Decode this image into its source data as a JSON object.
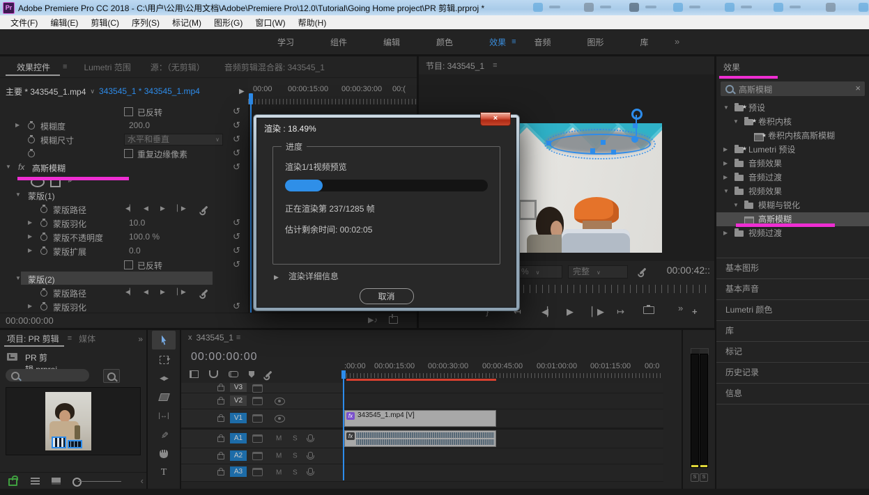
{
  "colors": {
    "accent": "#2d8ceb",
    "annotation": "#ee2ed2",
    "render_red": "#d8402f",
    "progress_blue": "#2f8fe8",
    "track_blue": "#1d6ca8",
    "workspace_active": "#3a8bd8"
  },
  "glyphs": {
    "panel_menu": "≡",
    "overflow": "»",
    "dropdown": "∨",
    "caret_down": "▼",
    "caret_right": "▶",
    "reset": "↺",
    "clear": "×",
    "chevron_left": "‹",
    "note": "▶♪",
    "plus": "+",
    "tab_close": "x",
    "head_arrow": "▶"
  },
  "title_bar": {
    "app_name": "Pr",
    "title": "Adobe Premiere Pro CC 2018 - C:\\用户\\公用\\公用文档\\Adobe\\Premiere Pro\\12.0\\Tutorial\\Going Home project\\PR 剪辑.prproj *"
  },
  "menu_bar": {
    "items": [
      "文件(F)",
      "编辑(E)",
      "剪辑(C)",
      "序列(S)",
      "标记(M)",
      "图形(G)",
      "窗口(W)",
      "帮助(H)"
    ]
  },
  "workspace": {
    "tabs": [
      "学习",
      "组件",
      "编辑",
      "颜色",
      "效果",
      "音频",
      "图形",
      "库"
    ],
    "active": "效果",
    "overflow": "»"
  },
  "effect_controls": {
    "tabs": [
      "效果控件",
      "Lumetri 范围",
      "源：（无剪辑）",
      "音频剪辑混合器: 343545_1"
    ],
    "master_label": "主要 * 343545_1.mp4",
    "clip_label": "343545_1 * 343545_1.mp4",
    "ruler": [
      "00:00",
      "00:00:15:00",
      "00:00:30:00",
      "00:("
    ],
    "kf": [
      "◀▏",
      "◀",
      "▶",
      "▏▶"
    ],
    "rows": [
      {
        "label": "已反转"
      },
      {
        "label": "模糊度",
        "value": "200.0"
      },
      {
        "label": "模糊尺寸",
        "value": "水平和垂直"
      },
      {
        "label": "重复边缘像素"
      },
      {
        "fx": "fx",
        "label": "高斯模糊"
      },
      {
        "label": ""
      },
      {
        "label": "蒙版(1)"
      },
      {
        "label": "蒙版路径"
      },
      {
        "label": "蒙版羽化",
        "value": "10.0"
      },
      {
        "label": "蒙版不透明度",
        "value": "100.0 %"
      },
      {
        "label": "蒙版扩展",
        "value": "0.0"
      },
      {
        "label": "已反转"
      },
      {
        "label": "蒙版(2)"
      },
      {
        "label": "蒙版路径"
      },
      {
        "label": "蒙版羽化"
      }
    ],
    "timecode": "00:00:00:00"
  },
  "program": {
    "title": "节目: 343545_1",
    "zoom": "%",
    "resolution": "完整",
    "timecode": "00:00:42::",
    "transport": {
      "mark_out": "}",
      "go_in": "↤",
      "step_back": "◀▏",
      "play": "▶",
      "step_fwd": "▏▶",
      "go_out": "↦",
      "more": "»",
      "add": "+"
    }
  },
  "dialog": {
    "title": "渲染 : 18.49%",
    "close": "×",
    "group": "进度",
    "task": "渲染1/1视频预览",
    "progress_percent": 18.49,
    "frame_text": "正在渲染第 237/1285 帧",
    "eta_text": "估计剩余时间: 00:02:05",
    "details": "渲染详细信息",
    "cancel": "取消"
  },
  "effects_panel": {
    "title": "效果",
    "search_text": "高斯模糊",
    "tree": [
      {
        "label": "预设"
      },
      {
        "label": "卷积内核"
      },
      {
        "label": "卷积内核高斯模糊"
      },
      {
        "label": "Lumetri 预设"
      },
      {
        "label": "音频效果"
      },
      {
        "label": "音频过渡"
      },
      {
        "label": "视频效果"
      },
      {
        "label": "模糊与锐化"
      },
      {
        "label": "高斯模糊"
      },
      {
        "label": "视频过渡"
      }
    ]
  },
  "side_tabs": [
    "基本图形",
    "基本声音",
    "Lumetri 颜色",
    "库",
    "标记",
    "历史记录",
    "信息"
  ],
  "project": {
    "tab": "项目: PR 剪辑",
    "tab_media": "媒体",
    "overflow": "»",
    "file": "PR 剪辑.prproj"
  },
  "tools": {
    "type_glyph": "T"
  },
  "timeline": {
    "tab": "343545_1",
    "timecode": "00:00:00:00",
    "ruler": [
      ":00:00",
      "00:00:15:00",
      "00:00:30:00",
      "00:00:45:00",
      "00:01:00:00",
      "00:01:15:00",
      "00:0"
    ],
    "video_tracks": [
      "V3",
      "V2",
      "V1"
    ],
    "audio_tracks": [
      "A1",
      "A2",
      "A3"
    ],
    "video_clip": "343545_1.mp4 [V]",
    "fx_badge": "fx",
    "ms": {
      "mute": "M",
      "solo": "S"
    }
  },
  "meters": {
    "solo": "S"
  }
}
